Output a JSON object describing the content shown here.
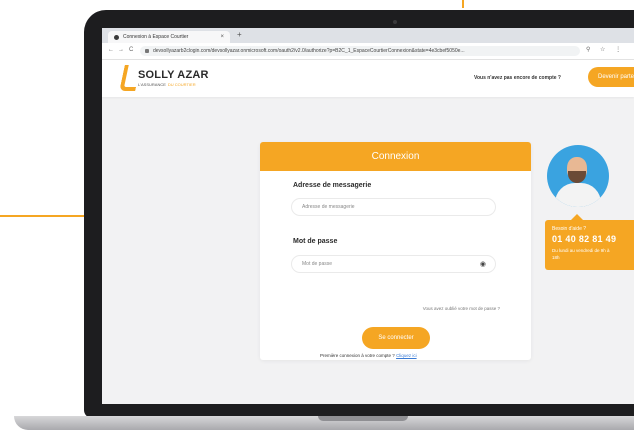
{
  "browser": {
    "tab_title": "Connexion à Espace Courtier",
    "tab_close": "×",
    "new_tab": "+",
    "back": "←",
    "forward": "→",
    "reload": "C",
    "url": "devsollyazarb2clogin.com/devsollyazar.onmicrosoft.com/oauth2/v2.0/authorize?p=B2C_1_EspaceCourtierConnexion&state=4e3cbef5050e...",
    "toolbar_icons": "⚲ ☆ ⋮"
  },
  "site": {
    "logo_text": "SOLLY AZAR",
    "logo_tag_1": "L'ASSURANCE",
    "logo_tag_2": "DU COURTIER",
    "signup_question": "Vous n'avez pas encore de compte ?",
    "signup_button": "Devenir partenaire"
  },
  "login": {
    "title": "Connexion",
    "email_label": "Adresse de messagerie",
    "email_placeholder": "Adresse de messagerie",
    "password_label": "Mot de passe",
    "password_placeholder": "Mot de passe",
    "forgot_password": "Vous avez oublié votre mot de passe ?",
    "submit": "Se connecter",
    "first_login_text": "Première connexion à votre compte ?",
    "first_login_link": "Cliquez ici"
  },
  "help": {
    "question": "Besoin d'aide ?",
    "phone": "01 40 82 81 49",
    "hours": "Du lundi au vendredi de 9h à 18h"
  },
  "colors": {
    "accent": "#f5a623",
    "laptop_frame": "#1d1d1f",
    "avatar_bg": "#3aa3e0"
  }
}
